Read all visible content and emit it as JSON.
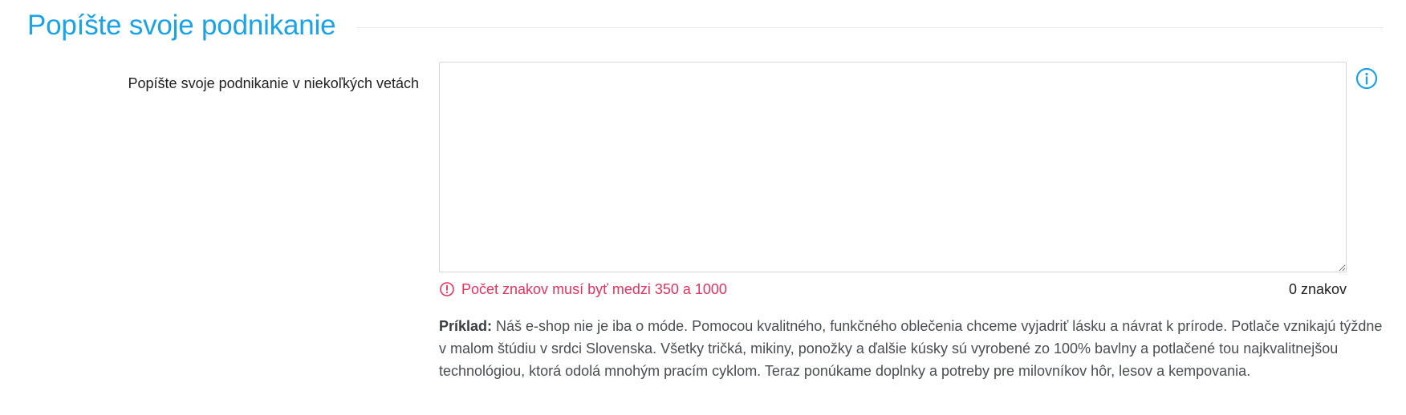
{
  "section": {
    "title": "Popíšte svoje podnikanie"
  },
  "field": {
    "label": "Popíšte svoje podnikanie v niekoľkých vetách",
    "value": "",
    "error": "Počet znakov musí byť medzi 350 a 1000",
    "char_count": "0 znakov"
  },
  "example": {
    "label": "Príklad:",
    "text": " Náš e-shop nie je iba o móde. Pomocou kvalitného, funkčného oblečenia chceme vyjadriť lásku a návrat k prírode. Potlače vznikajú týždne v malom štúdiu v srdci Slovenska. Všetky tričká, mikiny, ponožky a ďalšie kúsky sú vyrobené zo 100% bavlny a potlačené tou najkvalitnejšou technológiou, ktorá odolá mnohým pracím cyklom. Teraz ponúkame doplnky a potreby pre milovníkov hôr, lesov a kempovania."
  },
  "icons": {
    "info": "info-circle-icon",
    "error": "alert-circle-icon"
  },
  "colors": {
    "accent": "#1aa3e6",
    "error": "#e5325d"
  }
}
